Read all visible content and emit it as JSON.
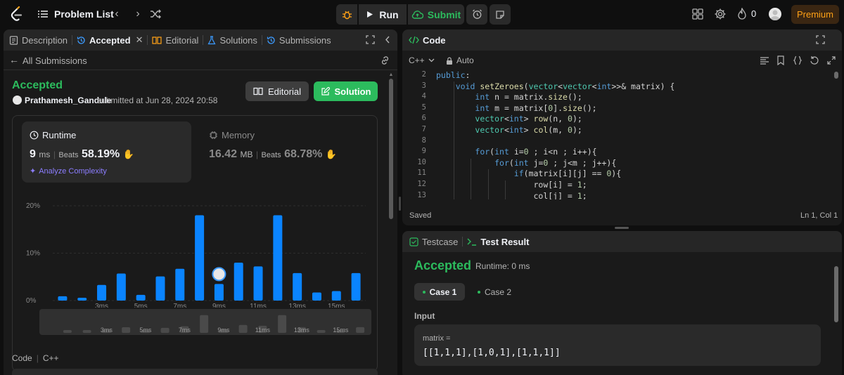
{
  "topbar": {
    "problem_list": "Problem List",
    "run": "Run",
    "submit": "Submit",
    "streak": "0",
    "premium": "Premium"
  },
  "left_tabs": [
    {
      "label": "Description"
    },
    {
      "label": "Accepted"
    },
    {
      "label": "Editorial"
    },
    {
      "label": "Solutions"
    },
    {
      "label": "Submissions"
    }
  ],
  "submission": {
    "back_label": "All Submissions",
    "status": "Accepted",
    "user": "Prathamesh_Gandule",
    "submitted": "submitted at Jun 28, 2024 20:58",
    "editorial_btn": "Editorial",
    "solution_btn": "Solution"
  },
  "runtime": {
    "label": "Runtime",
    "value": "9",
    "unit": "ms",
    "beats_label": "Beats",
    "beats": "58.19%",
    "analyze": "Analyze Complexity"
  },
  "memory": {
    "label": "Memory",
    "value": "16.42",
    "unit": "MB",
    "beats_label": "Beats",
    "beats": "68.78%"
  },
  "chart_data": {
    "type": "bar",
    "y_ticks": [
      "20%",
      "10%",
      "0%"
    ],
    "ylim": [
      0,
      20
    ],
    "x_tick_labels": [
      "3ms",
      "5ms",
      "7ms",
      "9ms",
      "11ms",
      "13ms",
      "15ms"
    ],
    "values": [
      0.9,
      0.6,
      3.3,
      5.7,
      1.2,
      5.1,
      6.7,
      18.0,
      3.5,
      8.0,
      7.2,
      18.0,
      5.8,
      1.7,
      2.0,
      5.8
    ],
    "highlight_index": 8,
    "bar_color": "#0a84ff"
  },
  "code_section": {
    "label": "Code",
    "lang": "C++"
  },
  "editor": {
    "title": "Code",
    "lang": "C++",
    "mode": "Auto",
    "status": "Saved",
    "position": "Ln 1, Col 1",
    "lines": [
      {
        "n": "2",
        "text": "public:"
      },
      {
        "n": "3",
        "text": "    void setZeroes(vector<vector<int>>& matrix) {"
      },
      {
        "n": "4",
        "text": "        int n = matrix.size();"
      },
      {
        "n": "5",
        "text": "        int m = matrix[0].size();"
      },
      {
        "n": "6",
        "text": "        vector<int> row(n, 0);"
      },
      {
        "n": "7",
        "text": "        vector<int> col(m, 0);"
      },
      {
        "n": "8",
        "text": ""
      },
      {
        "n": "9",
        "text": "        for(int i=0 ; i<n ; i++){"
      },
      {
        "n": "10",
        "text": "            for(int j=0 ; j<m ; j++){"
      },
      {
        "n": "11",
        "text": "                if(matrix[i][j] == 0){"
      },
      {
        "n": "12",
        "text": "                    row[i] = 1;"
      },
      {
        "n": "13",
        "text": "                    col[j] = 1;"
      }
    ]
  },
  "test": {
    "tab_testcase": "Testcase",
    "tab_result": "Test Result",
    "status": "Accepted",
    "runtime": "Runtime: 0 ms",
    "case1": "Case 1",
    "case2": "Case 2",
    "input_label": "Input",
    "var": "matrix =",
    "value": "[[1,1,1],[1,0,1],[1,1,1]]"
  }
}
